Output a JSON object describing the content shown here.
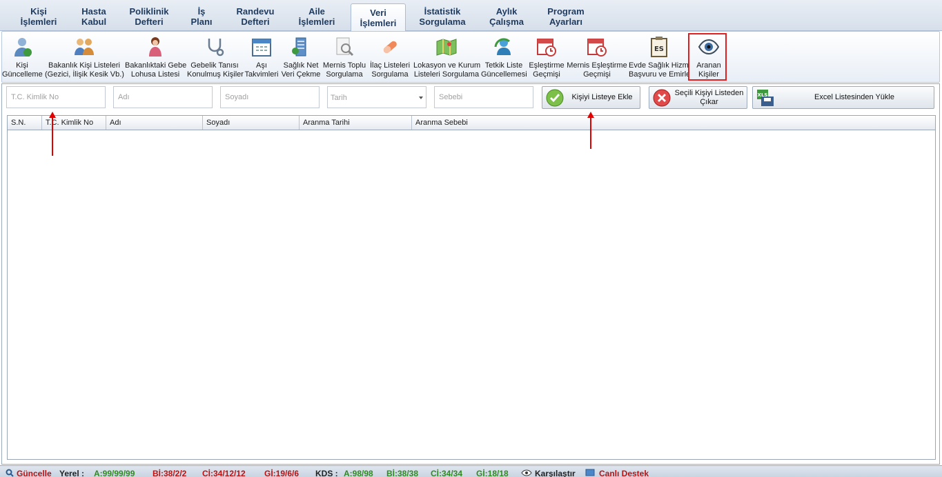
{
  "tabs": [
    {
      "line1": "Kişi",
      "line2": "İşlemleri"
    },
    {
      "line1": "Hasta",
      "line2": "Kabul"
    },
    {
      "line1": "Poliklinik",
      "line2": "Defteri"
    },
    {
      "line1": "İş",
      "line2": "Planı"
    },
    {
      "line1": "Randevu",
      "line2": "Defteri"
    },
    {
      "line1": "Aile",
      "line2": "İşlemleri"
    },
    {
      "line1": "Veri",
      "line2": "İşlemleri"
    },
    {
      "line1": "İstatistik",
      "line2": "Sorgulama"
    },
    {
      "line1": "Aylık",
      "line2": "Çalışma"
    },
    {
      "line1": "Program",
      "line2": "Ayarları"
    }
  ],
  "ribbon": [
    {
      "line1": "Kişi",
      "line2": "Güncelleme",
      "icon": "person-update-icon"
    },
    {
      "line1": "Bakanlık Kişi Listeleri",
      "line2": "(Gezici, İlişik Kesik Vb.)",
      "icon": "people-icon"
    },
    {
      "line1": "Bakanlıktaki Gebe",
      "line2": "Lohusa Listesi",
      "icon": "woman-icon"
    },
    {
      "line1": "Gebelik Tanısı",
      "line2": "Konulmuş Kişiler",
      "icon": "stethoscope-icon"
    },
    {
      "line1": "Aşı",
      "line2": "Takvimleri",
      "icon": "calendar-icon"
    },
    {
      "line1": "Sağlık Net",
      "line2": "Veri Çekme",
      "icon": "server-icon"
    },
    {
      "line1": "Mernis Toplu",
      "line2": "Sorgulama",
      "icon": "search-document-icon"
    },
    {
      "line1": "İlaç Listeleri",
      "line2": "Sorgulama",
      "icon": "pill-icon"
    },
    {
      "line1": "Lokasyon ve Kurum",
      "line2": "Listeleri Sorgulama",
      "icon": "map-icon"
    },
    {
      "line1": "Tetkik Liste",
      "line2": "Güncellemesi",
      "icon": "refresh-person-icon"
    },
    {
      "line1": "Eşleştirme",
      "line2": "Geçmişi",
      "icon": "calendar-clock-icon"
    },
    {
      "line1": "Mernis Eşleştirme",
      "line2": "Geçmişi",
      "icon": "calendar-clock-icon"
    },
    {
      "line1": "Evde Sağlık Hizmet",
      "line2": "Başvuru ve Emirler",
      "icon": "clipboard-es-icon",
      "badge": "ES"
    },
    {
      "line1": "Aranan",
      "line2": "Kişiler",
      "icon": "eye-icon"
    }
  ],
  "form": {
    "tc_placeholder": "T.C. Kimlik No",
    "name_placeholder": "Adı",
    "surname_placeholder": "Soyadı",
    "date_placeholder": "Tarih",
    "reason_placeholder": "Sebebi",
    "add_label": "Kişiyi Listeye Ekle",
    "remove_line1": "Seçili Kişiyi Listeden",
    "remove_line2": "Çıkar",
    "excel_label": "Excel Listesinden Yükle",
    "excel_badge": "XLS"
  },
  "grid": {
    "columns": [
      "S.N.",
      "T.C. Kimlik No",
      "Adı",
      "Soyadı",
      "Aranma Tarihi",
      "Aranma Sebebi"
    ]
  },
  "status": {
    "update": "Güncelle",
    "local": "Yerel :",
    "a1": "A:99/99/99",
    "b1": "Bİ:38/2/2",
    "c1": "Cİ:34/12/12",
    "g1": "Gİ:19/6/6",
    "kds": "KDS :",
    "a2": "A:98/98",
    "b2": "Bİ:38/38",
    "c2": "Cİ:34/34",
    "g2": "Gİ:18/18",
    "compare": "Karşılaştır",
    "support": "Canlı Destek"
  },
  "colors": {
    "accent": "#1e3a5f",
    "highlight": "#e02020",
    "ok": "#2e8b1e",
    "error": "#cc1010"
  }
}
